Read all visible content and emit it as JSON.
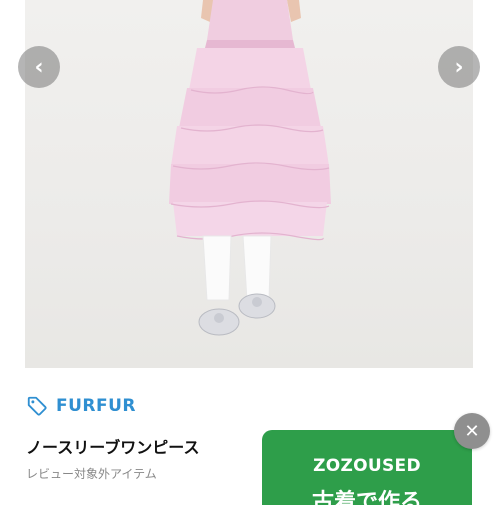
{
  "carousel": {
    "prev_icon": "chevron-left-icon",
    "next_icon": "chevron-right-icon",
    "prev_glyph": "‹",
    "next_glyph": "›"
  },
  "product": {
    "brand": "FURFUR",
    "brand_icon": "tag-icon",
    "title": "ノースリーブワンピース",
    "note": "レビュー対象外アイテム"
  },
  "banner": {
    "title": "ZOZOUSED",
    "subtitle": "古着で作る"
  },
  "close": {
    "icon": "close-icon",
    "glyph": "✕"
  },
  "colors": {
    "brand": "#2f8fd1",
    "banner": "#2e9e4a",
    "dress": "#f2cfe3"
  }
}
